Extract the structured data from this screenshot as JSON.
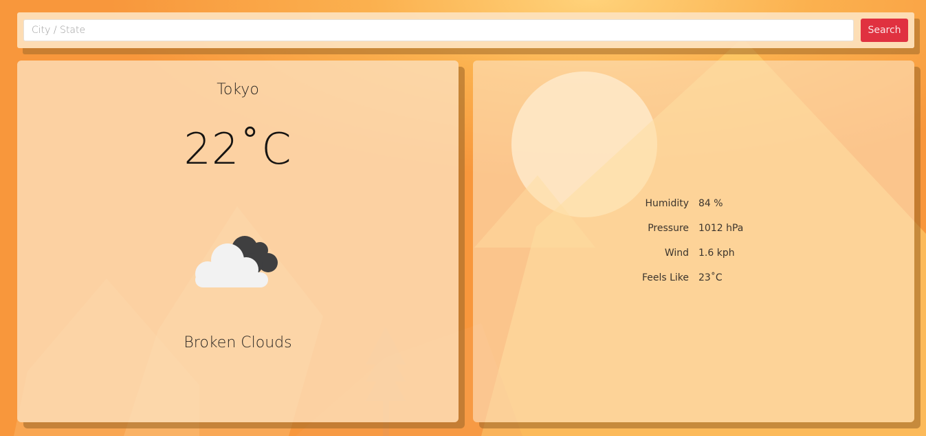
{
  "search": {
    "placeholder": "City / State",
    "value": "",
    "button_label": "Search"
  },
  "current": {
    "city": "Tokyo",
    "temperature": "22˚C",
    "condition": "Broken Clouds",
    "icon": "broken-clouds-icon"
  },
  "details": [
    {
      "label": "Humidity",
      "value": "84 %"
    },
    {
      "label": "Pressure",
      "value": "1012 hPa"
    },
    {
      "label": "Wind",
      "value": "1.6 kph"
    },
    {
      "label": "Feels Like",
      "value": "23˚C"
    }
  ],
  "colors": {
    "accent": "#e03140",
    "background": "#f8973c",
    "card": "#fde0bb",
    "text": "#2a2622"
  }
}
